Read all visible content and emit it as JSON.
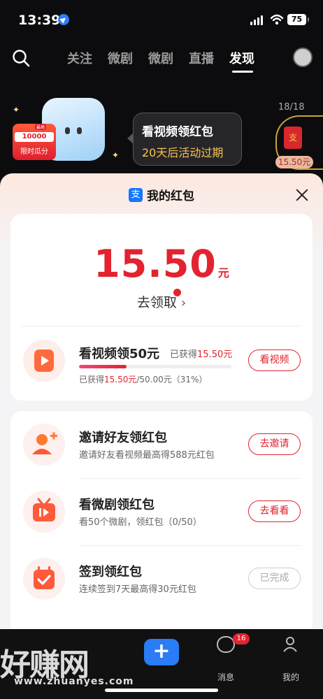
{
  "status_bar": {
    "time": "13:39",
    "battery": "75"
  },
  "top_nav": {
    "tabs": [
      {
        "label": "关注",
        "active": false
      },
      {
        "label": "微剧",
        "active": false
      },
      {
        "label": "微剧",
        "active": false
      },
      {
        "label": "直播",
        "active": false
      },
      {
        "label": "发现",
        "active": true
      }
    ]
  },
  "promo": {
    "badge_top": "最高",
    "badge_amount": "10000",
    "badge_label": "限时瓜分",
    "tooltip_title": "看视频领红包",
    "tooltip_subtitle": "20天后活动过期",
    "side_counter": "18/18",
    "side_packet_char": "支",
    "side_amount": "15.50元"
  },
  "sheet": {
    "title": "我的红包",
    "balance": "15.50",
    "balance_unit": "元",
    "claim_label": "去领取",
    "watch_task": {
      "title": "看视频领50元",
      "earned_prefix": "已获得",
      "earned_value": "15.50元",
      "progress_prefix": "已获得",
      "progress_value": "15.50元",
      "progress_rest": "/50.00元（31%）",
      "progress_fraction": 0.31,
      "button": "看视频"
    },
    "tasks": [
      {
        "title": "邀请好友领红包",
        "subtitle": "邀请好友看视频最高得588元红包",
        "button": "去邀请",
        "done": false
      },
      {
        "title": "看微剧领红包",
        "subtitle": "看50个微剧，领红包（0/50）",
        "button": "去看看",
        "done": false
      },
      {
        "title": "签到领红包",
        "subtitle": "连续签到7天最高得30元红包",
        "button": "已完成",
        "done": true
      }
    ]
  },
  "tabbar": {
    "messages_label": "消息",
    "messages_badge": "16",
    "me_label": "我的"
  },
  "watermark": {
    "text": "好赚网",
    "url": "www.zhuanyes.com"
  },
  "colors": {
    "accent_red": "#e3232f",
    "plus_blue": "#2a7cf7",
    "alipay_blue": "#1677ff"
  }
}
